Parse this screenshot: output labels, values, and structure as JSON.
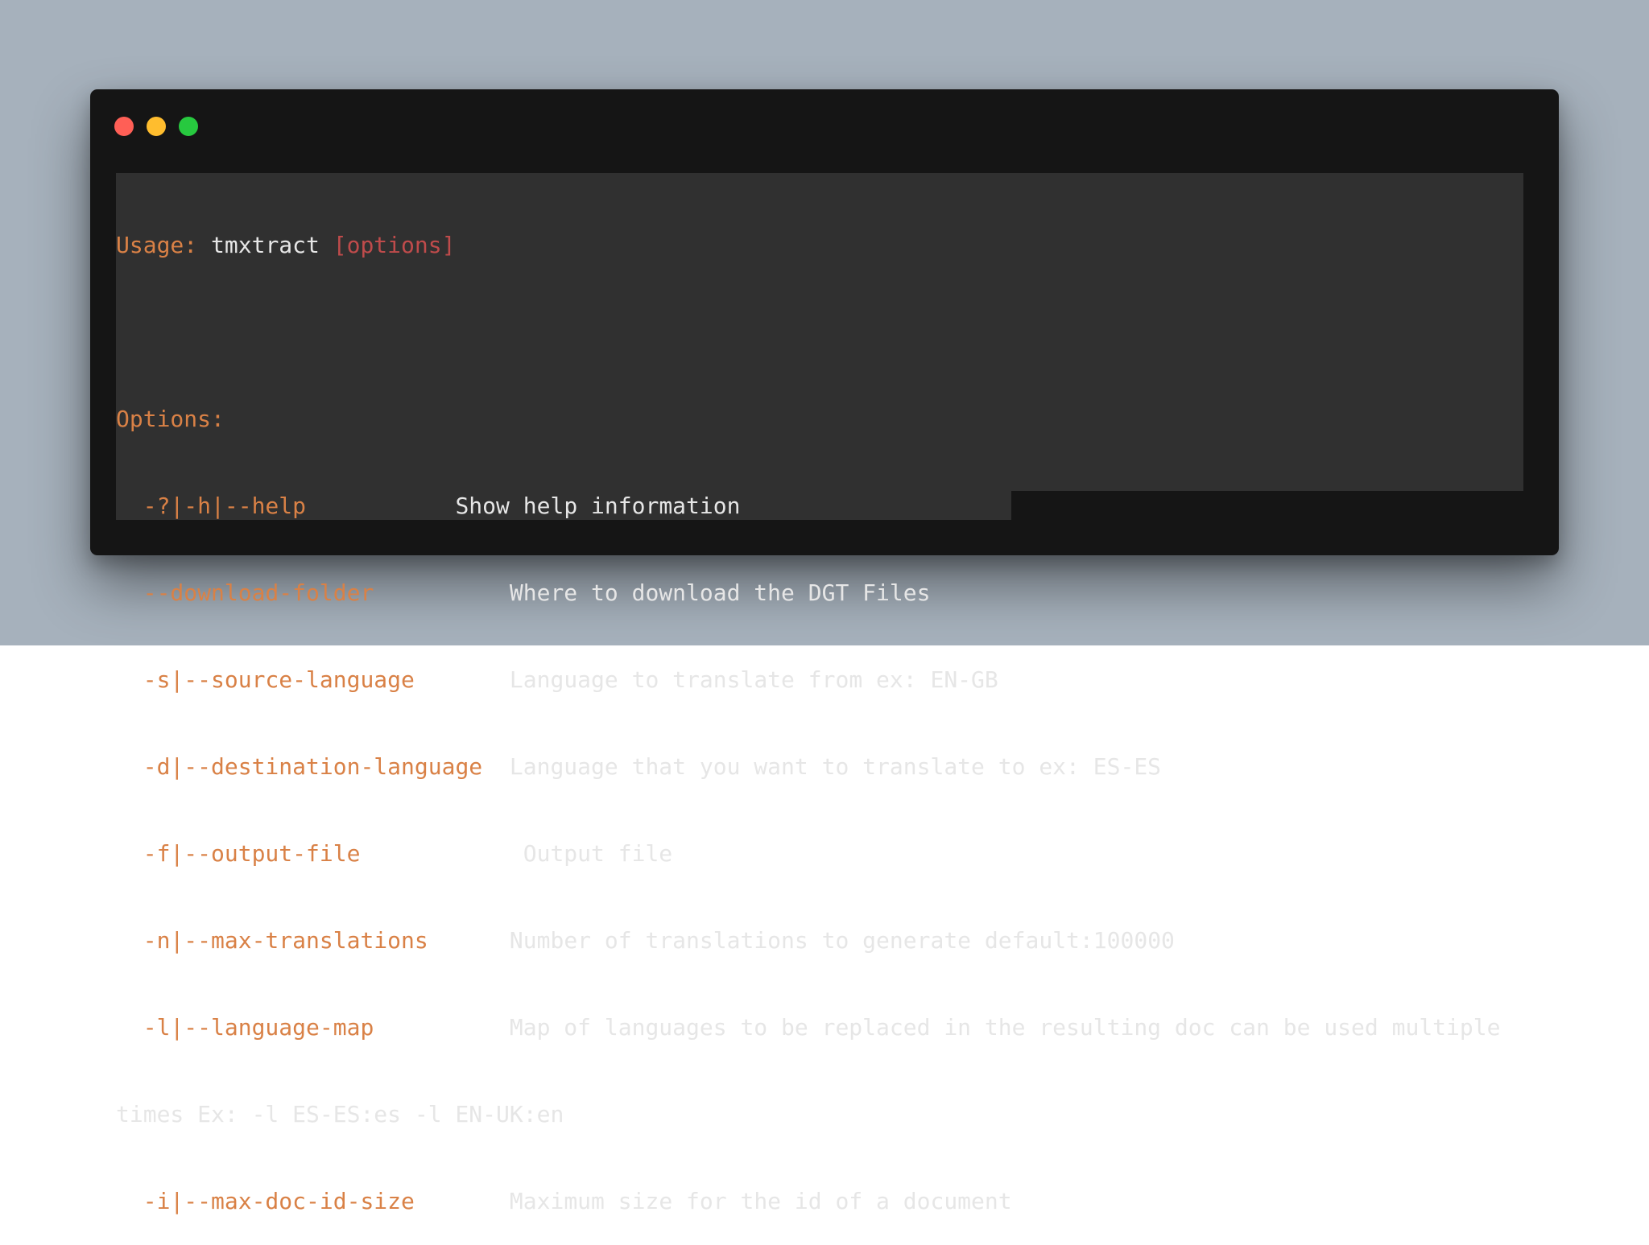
{
  "terminal": {
    "usage_label": "Usage:",
    "command": "tmxtract",
    "options_placeholder": "[options]",
    "options_heading": "Options:",
    "options": [
      {
        "flag": "-?|-h|--help",
        "description": "Show help information"
      },
      {
        "flag": "--download-folder",
        "description": "Where to download the DGT Files"
      },
      {
        "flag": "-s|--source-language",
        "description": "Language to translate from ex: EN-GB"
      },
      {
        "flag": "-d|--destination-language",
        "description": "Language that you want to translate to ex: ES-ES"
      },
      {
        "flag": "-f|--output-file",
        "description": "Output file"
      },
      {
        "flag": "-n|--max-translations",
        "description": "Number of translations to generate default:100000"
      },
      {
        "flag": "-l|--language-map",
        "description": "Map of languages to be replaced in the resulting doc can be used multiple",
        "continuation": "times Ex: -l ES-ES:es -l EN-UK:en"
      },
      {
        "flag": "-i|--max-doc-id-size",
        "description": "Maximum size for the id of a document"
      }
    ]
  },
  "colors": {
    "background": "#a6b1bc",
    "window": "#151515",
    "selection": "#303030",
    "flag": "#d98146",
    "placeholder": "#bf4b4b",
    "text": "#e6e6e6",
    "close": "#ff5f56",
    "minimize": "#ffbd2e",
    "maximize": "#27c93f"
  }
}
